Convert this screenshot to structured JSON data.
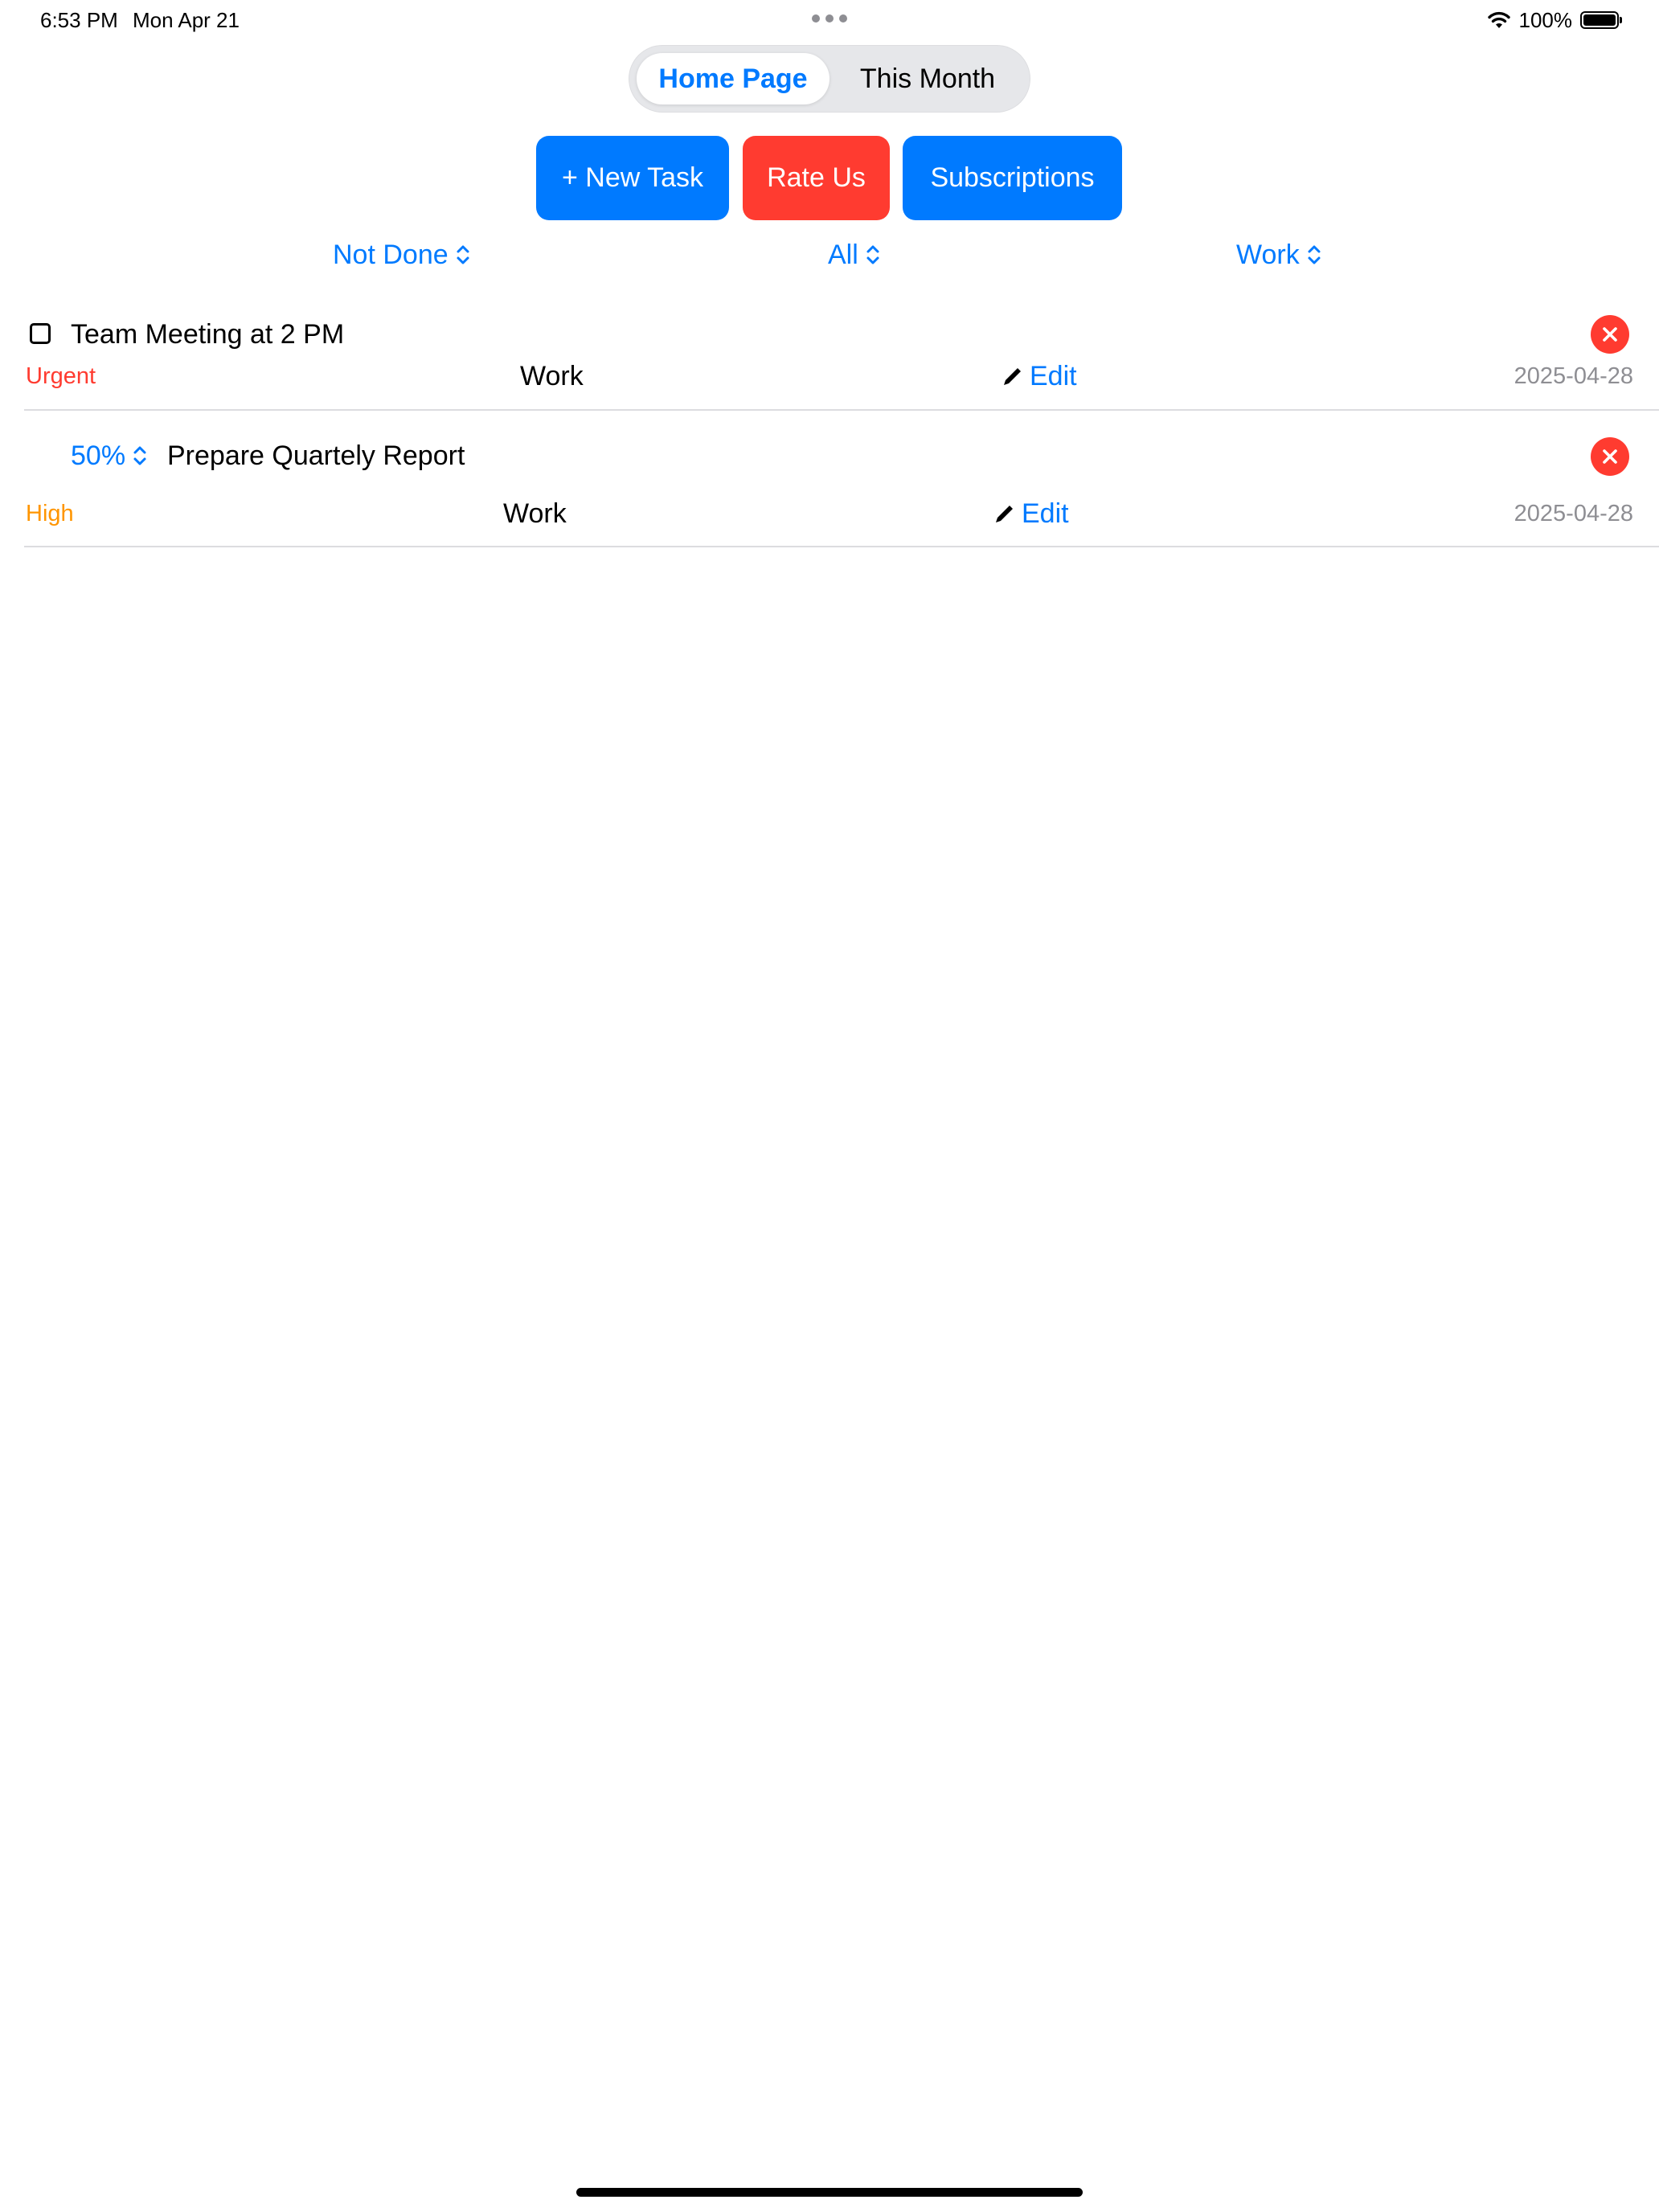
{
  "status_bar": {
    "time": "6:53 PM",
    "date": "Mon Apr 21",
    "battery": "100%",
    "wifi_icon": "wifi-icon",
    "battery_icon": "battery-icon"
  },
  "segments": {
    "active": "Home Page",
    "inactive": "This Month"
  },
  "actions": {
    "new_task": "+ New Task",
    "rate_us": "Rate Us",
    "subscriptions": "Subscriptions"
  },
  "filters": {
    "status": "Not Done",
    "priority": "All",
    "category": "Work"
  },
  "tasks": [
    {
      "title": "Team Meeting at 2 PM",
      "priority": "Urgent",
      "priority_color": "#ff3b30",
      "category": "Work",
      "edit_label": "Edit",
      "date": "2025-04-28"
    },
    {
      "progress": "50%",
      "title": "Prepare Quartely Report",
      "priority": "High",
      "priority_color": "#ff9500",
      "category": "Work",
      "edit_label": "Edit",
      "date": "2025-04-28"
    }
  ],
  "colors": {
    "accent": "#007aff",
    "destructive": "#ff3b30",
    "warning": "#ff9500",
    "secondary_text": "#8e8e93"
  }
}
